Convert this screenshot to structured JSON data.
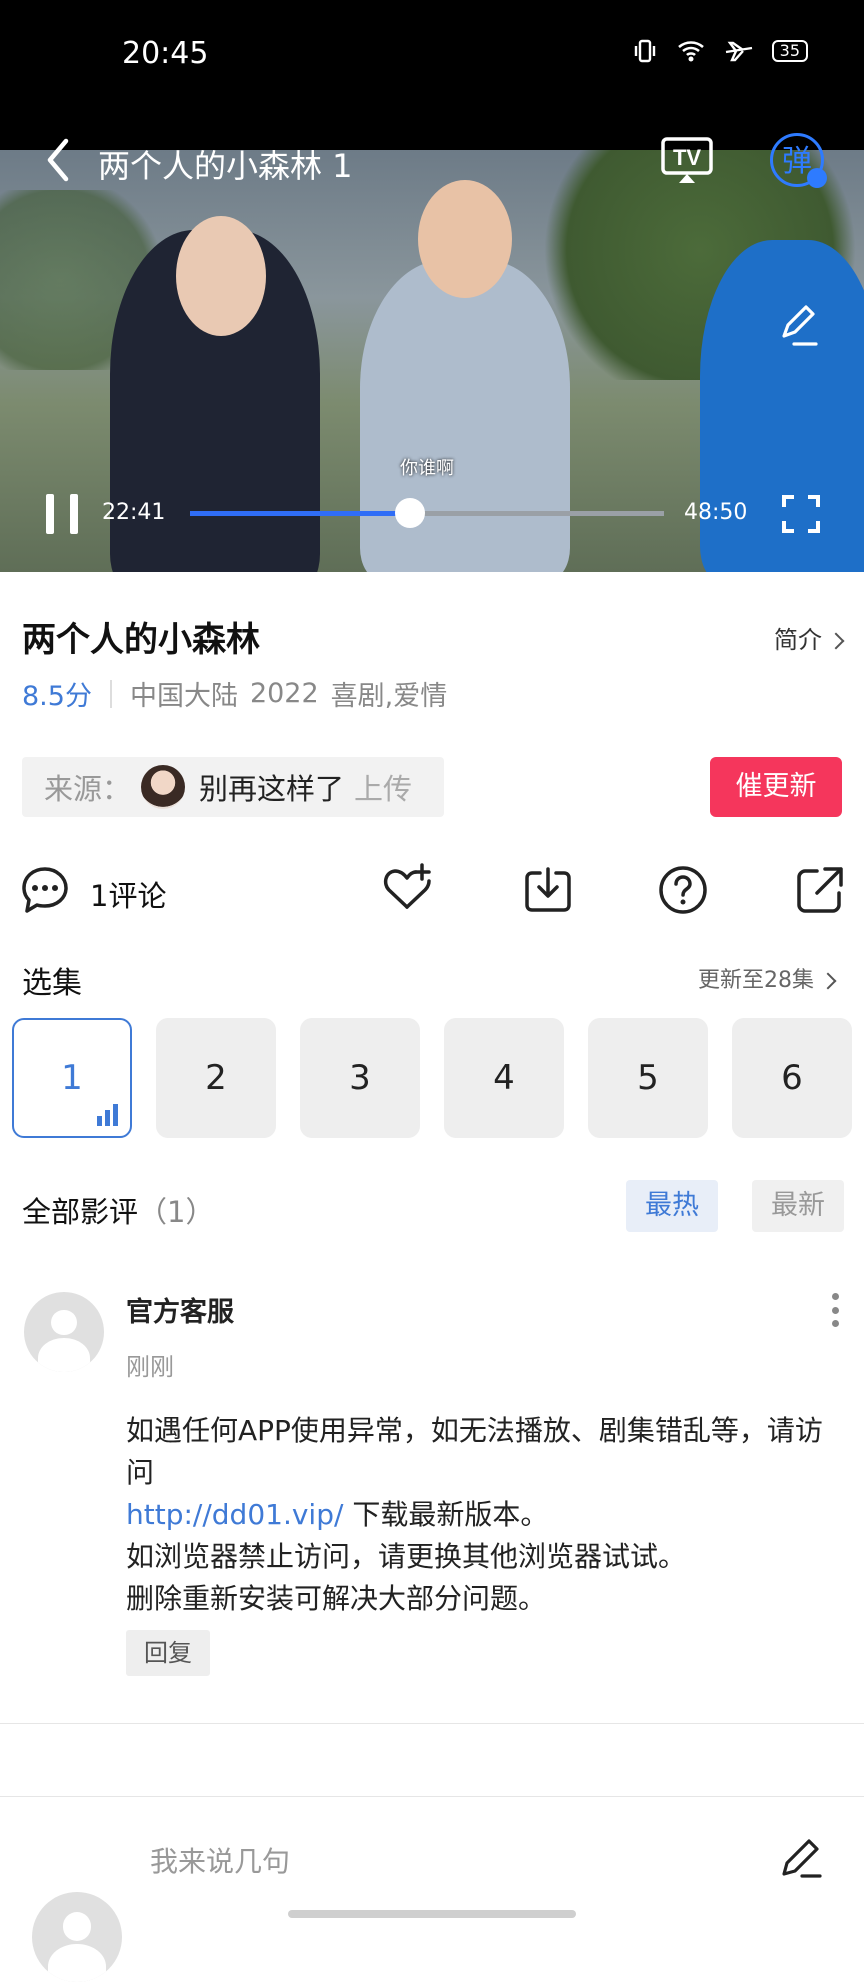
{
  "status_bar": {
    "time": "20:45",
    "battery": "35"
  },
  "player": {
    "title": "两个人的小森林 1",
    "subtitle": "你谁啊",
    "current_time": "22:41",
    "total_time": "48:50",
    "progress": 0.465,
    "danmaku_label": "弹",
    "tv_label": "TV"
  },
  "info": {
    "title": "两个人的小森林",
    "intro_label": "简介",
    "rating": "8.5分",
    "region": "中国大陆",
    "year": "2022",
    "genres": "喜剧,爱情"
  },
  "source": {
    "prefix": "来源：",
    "uploader": "别再这样了",
    "suffix": "上传",
    "urge_button": "催更新"
  },
  "actions": {
    "comments_label": "1评论"
  },
  "episodes": {
    "label": "选集",
    "update_text": "更新至28集",
    "items": [
      "1",
      "2",
      "3",
      "4",
      "5",
      "6"
    ],
    "active_index": 0
  },
  "reviews": {
    "title": "全部影评",
    "count": "（1）",
    "sort_hot": "最热",
    "sort_new": "最新",
    "items": [
      {
        "user": "官方客服",
        "time": "刚刚",
        "line1": "如遇任何APP使用异常，如无法播放、剧集错乱等，请访问",
        "link": "http://dd01.vip/",
        "line2": " 下载最新版本。",
        "line3": "如浏览器禁止访问，请更换其他浏览器试试。",
        "line4": "删除重新安装可解决大部分问题。",
        "reply_label": "回复"
      }
    ]
  },
  "composer": {
    "placeholder": "我来说几句"
  },
  "colors": {
    "accent": "#3f7ad6",
    "urge": "#f5365c",
    "progress": "#2f6df6"
  }
}
